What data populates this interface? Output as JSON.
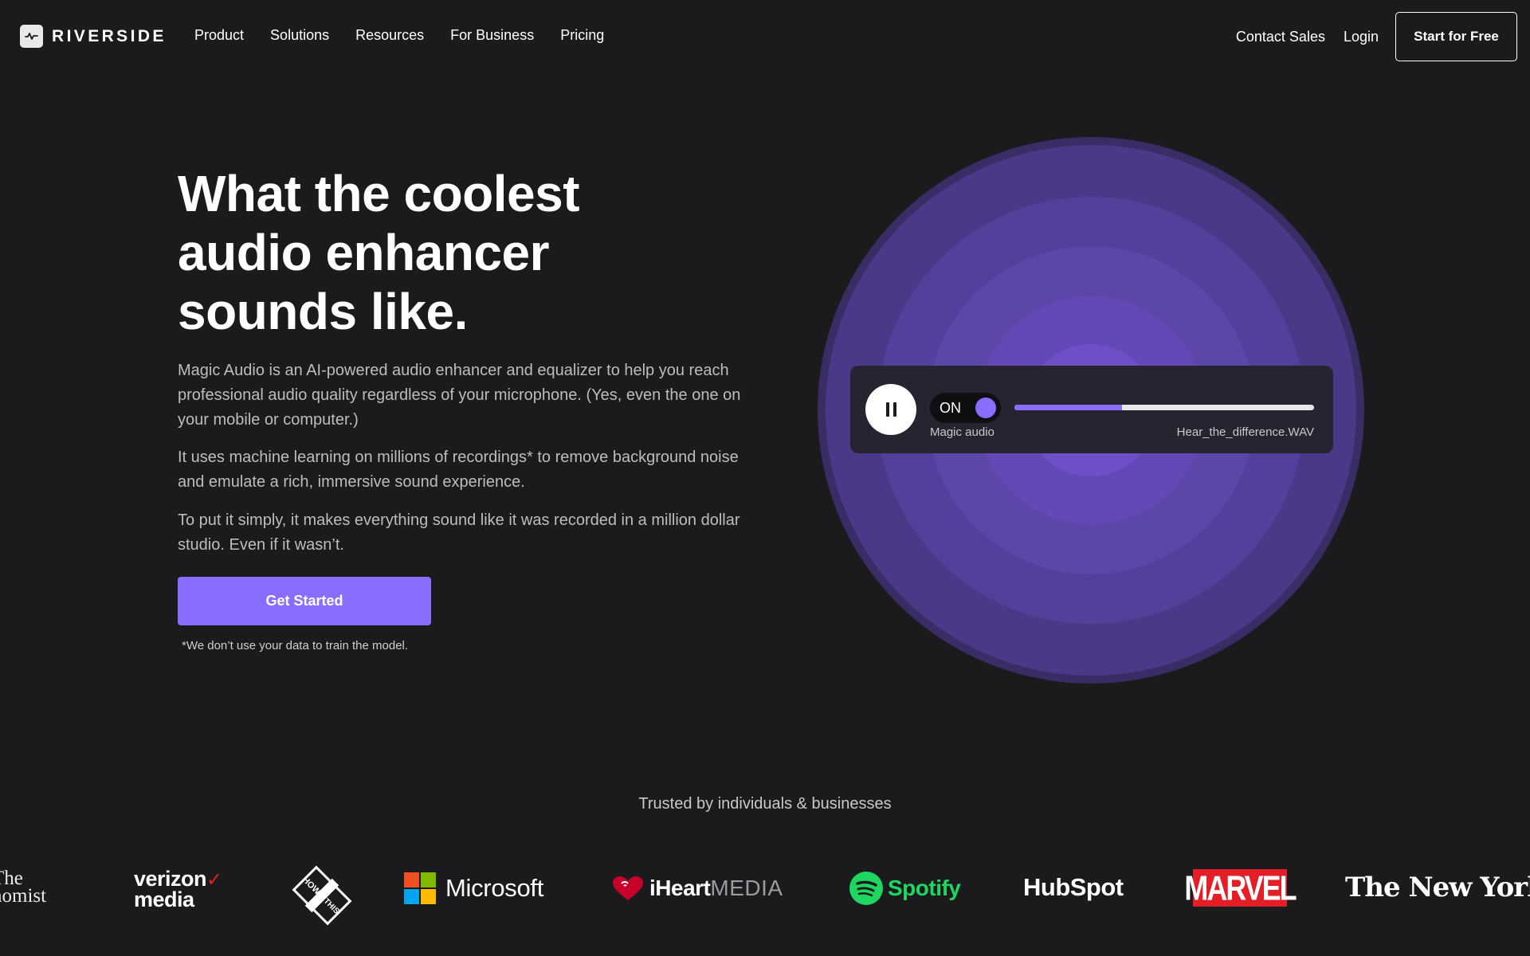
{
  "nav": {
    "logo_text": "RIVERSIDE",
    "links": [
      "Product",
      "Solutions",
      "Resources",
      "For Business",
      "Pricing"
    ],
    "contact_sales": "Contact Sales",
    "login": "Login",
    "start_free": "Start for Free"
  },
  "hero": {
    "title": "What the coolest audio enhancer sounds like.",
    "paragraphs": [
      "Magic Audio is an AI-powered audio enhancer and equalizer to help you reach professional audio quality regardless of your microphone. (Yes, even the one on your mobile or computer.)",
      "It uses machine learning on millions of recordings* to remove background noise and emulate a rich, immersive sound experience.",
      "To put it simply, it makes everything sound like it was recorded in a million dollar studio. Even if it wasn’t."
    ],
    "cta": "Get Started",
    "disclaimer": "*We don’t use your data to train the model."
  },
  "player": {
    "toggle_state": "ON",
    "label": "Magic audio",
    "filename": "Hear_the_difference.WAV",
    "progress": 0.36,
    "accent": "#8a6dff"
  },
  "trusted": {
    "heading": "Trusted by individuals & businesses",
    "brands": {
      "economist": [
        "The",
        "nomist"
      ],
      "verizon": [
        "verizon",
        "media"
      ],
      "how_i_built_this": "HOW I BUILT THIS",
      "microsoft": "Microsoft",
      "iheart_bold": "iHeart",
      "iheart_light": "MEDIA",
      "spotify": "Spotify",
      "hubspot": "HubSpot",
      "marvel": "MARVEL",
      "nyt": "The New York Ti"
    }
  }
}
